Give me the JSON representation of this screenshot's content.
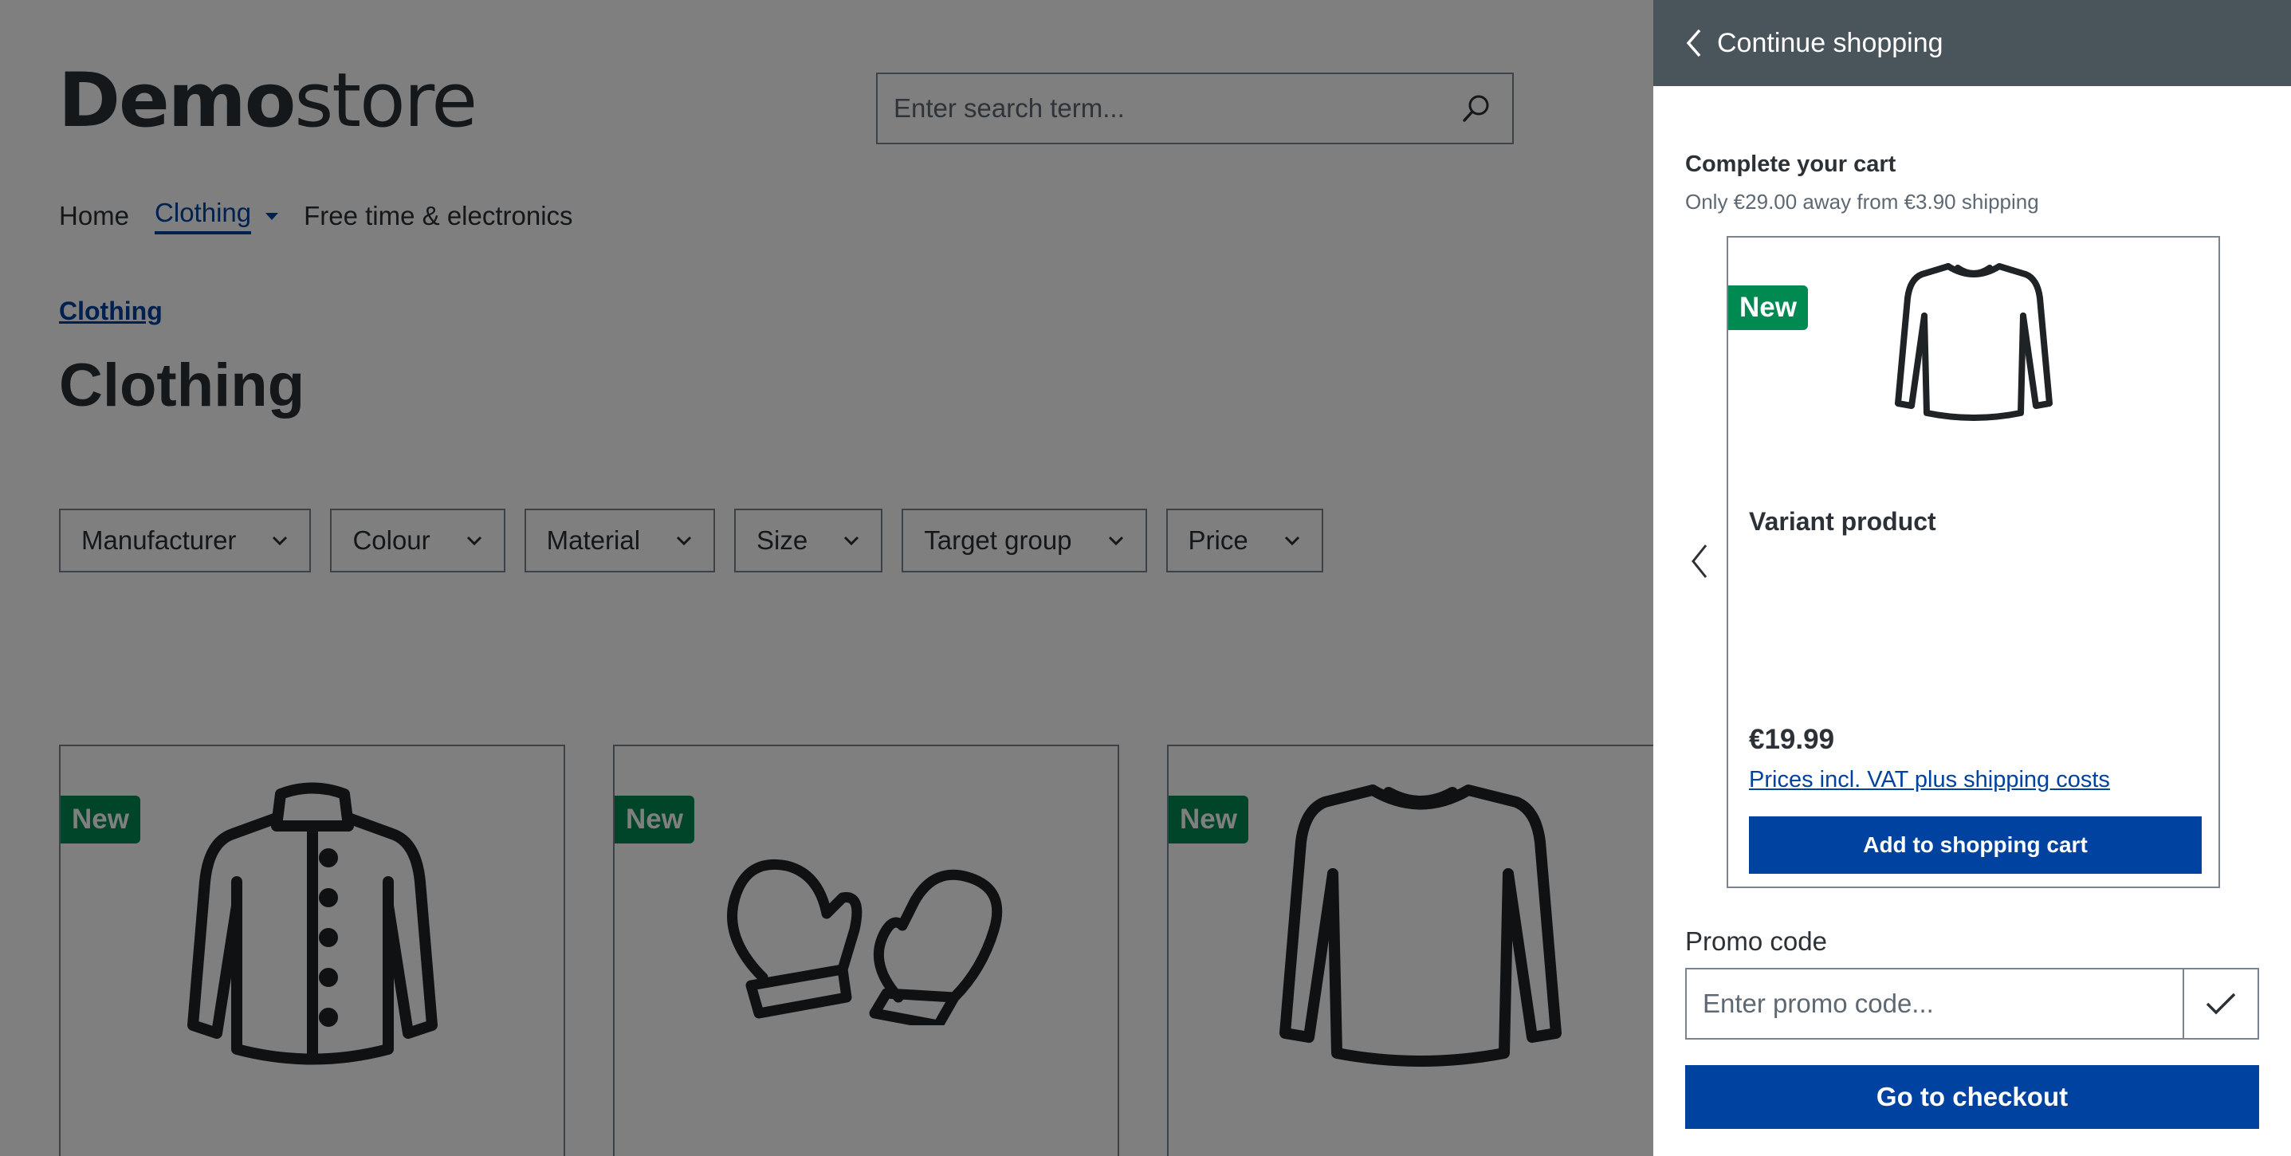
{
  "store": {
    "logo_bold": "Demo",
    "logo_light": "store",
    "search_placeholder": "Enter search term..."
  },
  "nav": {
    "items": [
      {
        "label": "Home"
      },
      {
        "label": "Clothing"
      },
      {
        "label": "Free time & electronics"
      }
    ]
  },
  "breadcrumb": "Clothing",
  "page_title": "Clothing",
  "filters": [
    {
      "label": "Manufacturer"
    },
    {
      "label": "Colour"
    },
    {
      "label": "Material"
    },
    {
      "label": "Size"
    },
    {
      "label": "Target group"
    },
    {
      "label": "Price"
    }
  ],
  "products": [
    {
      "badge": "New",
      "icon": "jacket-icon"
    },
    {
      "badge": "New",
      "icon": "mittens-icon"
    },
    {
      "badge": "New",
      "icon": "longsleeve-shirt-icon"
    }
  ],
  "offcanvas": {
    "back_label": "Continue shopping",
    "cross_selling": {
      "title": "Complete your cart",
      "shipping_note": "Only €29.00 away from €3.90 shipping"
    },
    "slide": {
      "badge": "New",
      "name": "Variant product",
      "price": "€19.99",
      "vat_note": "Prices incl. VAT plus shipping costs",
      "add_label": "Add to shopping cart"
    },
    "promo": {
      "label": "Promo code",
      "placeholder": "Enter promo code..."
    },
    "checkout_label": "Go to checkout"
  },
  "colors": {
    "primary": "#0042a0",
    "badge": "#008a52",
    "header": "#4a545b"
  }
}
